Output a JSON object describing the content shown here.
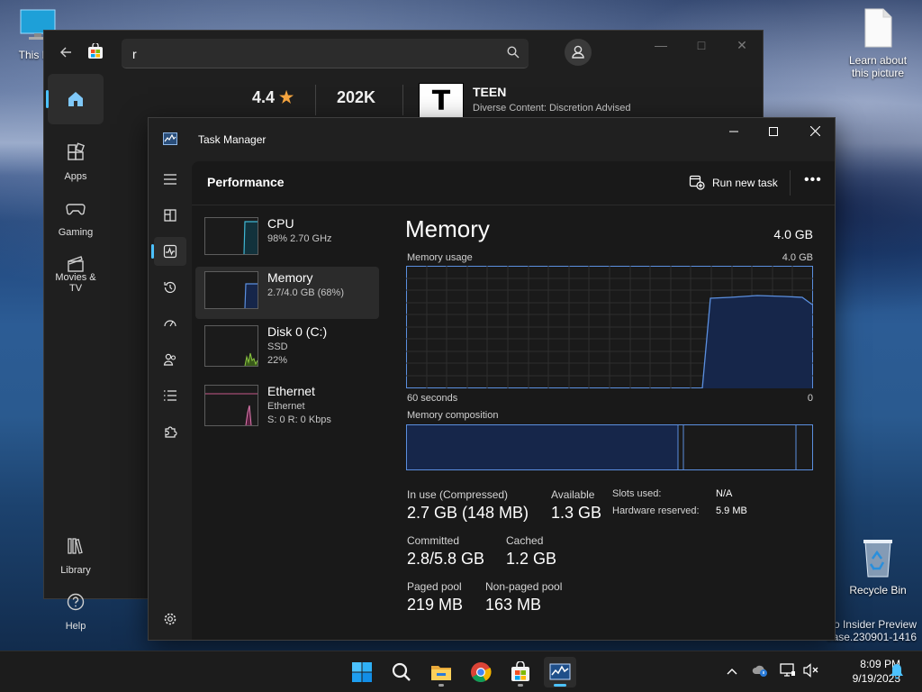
{
  "desktop": {
    "this_pc_label": "This PC",
    "learn_label_1": "Learn about",
    "learn_label_2": "this picture",
    "recycle_label": "Recycle Bin",
    "watermark_1": "ro Insider Preview",
    "watermark_2": "ease.230901-1416"
  },
  "store": {
    "search_value": "r",
    "nav": [
      {
        "label": "",
        "icon": "home-icon"
      },
      {
        "label": "Apps",
        "icon": "apps-icon"
      },
      {
        "label": "Gaming",
        "icon": "gamepad-icon"
      },
      {
        "label": "Movies & TV",
        "icon": "film-icon"
      },
      {
        "label": "Library",
        "icon": "library-icon"
      },
      {
        "label": "Help",
        "icon": "help-icon"
      }
    ],
    "rating": "4.4",
    "review_count": "202K",
    "esrb_letter": "T",
    "esrb_title": "TEEN",
    "esrb_desc": "Diverse Content: Discretion Advised"
  },
  "taskmanager": {
    "title": "Task Manager",
    "page_title": "Performance",
    "run_new_task": "Run new task",
    "more": "•••",
    "resources": [
      {
        "name": "CPU",
        "sub1": "98% 2.70 GHz",
        "sub2": ""
      },
      {
        "name": "Memory",
        "sub1": "2.7/4.0 GB (68%)",
        "sub2": ""
      },
      {
        "name": "Disk 0 (C:)",
        "sub1": "SSD",
        "sub2": "22%"
      },
      {
        "name": "Ethernet",
        "sub1": "Ethernet",
        "sub2": "S: 0 R: 0 Kbps"
      }
    ],
    "detail": {
      "title": "Memory",
      "total": "4.0 GB",
      "usage_label": "Memory usage",
      "usage_max": "4.0 GB",
      "time_label": "60 seconds",
      "time_end": "0",
      "composition_label": "Memory composition",
      "in_use_label": "In use (Compressed)",
      "in_use_value": "2.7 GB (148 MB)",
      "available_label": "Available",
      "available_value": "1.3 GB",
      "committed_label": "Committed",
      "committed_value": "2.8/5.8 GB",
      "cached_label": "Cached",
      "cached_value": "1.2 GB",
      "paged_label": "Paged pool",
      "paged_value": "219 MB",
      "nonpaged_label": "Non-paged pool",
      "nonpaged_value": "163 MB",
      "slots_label": "Slots used:",
      "slots_value": "N/A",
      "hwres_label": "Hardware reserved:",
      "hwres_value": "5.9 MB"
    }
  },
  "taskbar": {
    "time": "8:09 PM",
    "date": "9/19/2023"
  },
  "colors": {
    "accent": "#4cc2ff",
    "memory_line": "#5b8fdf",
    "memory_fill": "#16264a"
  }
}
